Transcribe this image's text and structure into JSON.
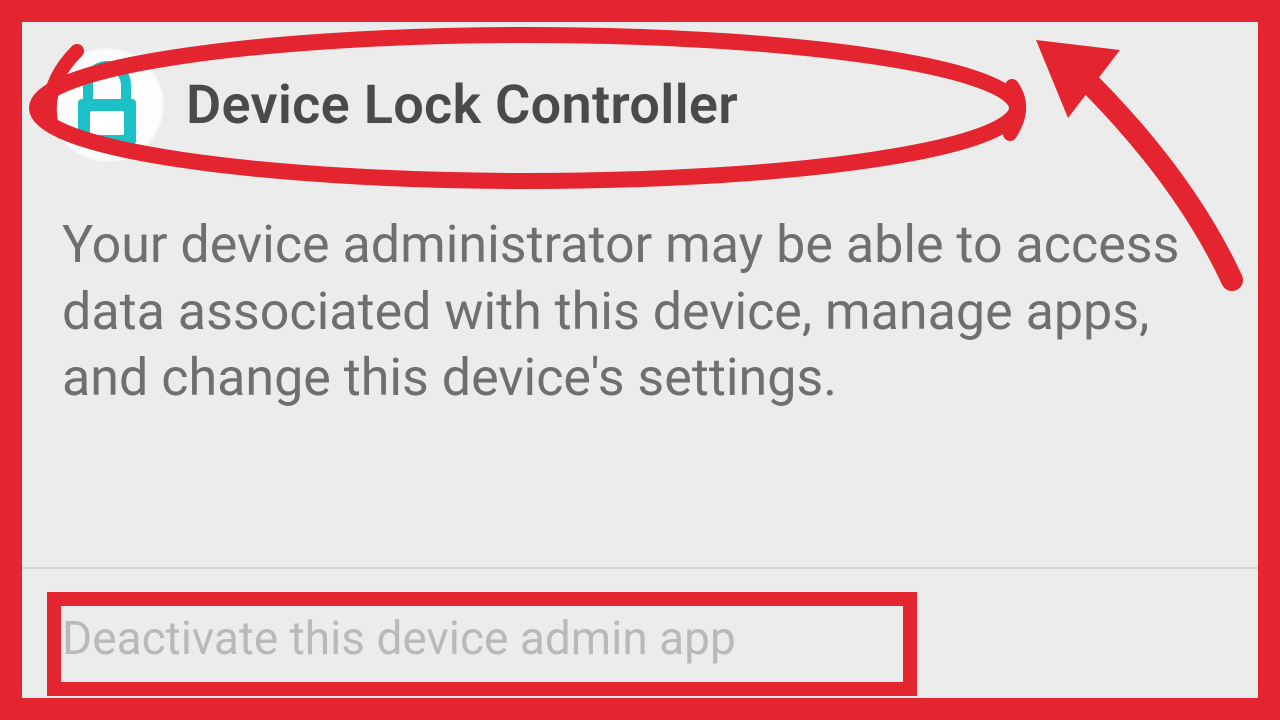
{
  "colors": {
    "accent_red": "#e4252f",
    "icon_teal": "#1cc0c7",
    "icon_dark": "#0a6a6f"
  },
  "header": {
    "app_title": "Device Lock Controller",
    "icon_name": "lock-icon"
  },
  "body": {
    "description": "Your device administrator may be able to access data associated with this device, manage apps, and change this device's settings."
  },
  "footer": {
    "deactivate_label": "Deactivate this device admin app"
  },
  "annotations": {
    "ellipse_over_header": true,
    "arrow_pointing_header": true,
    "rect_over_deactivate": true
  }
}
